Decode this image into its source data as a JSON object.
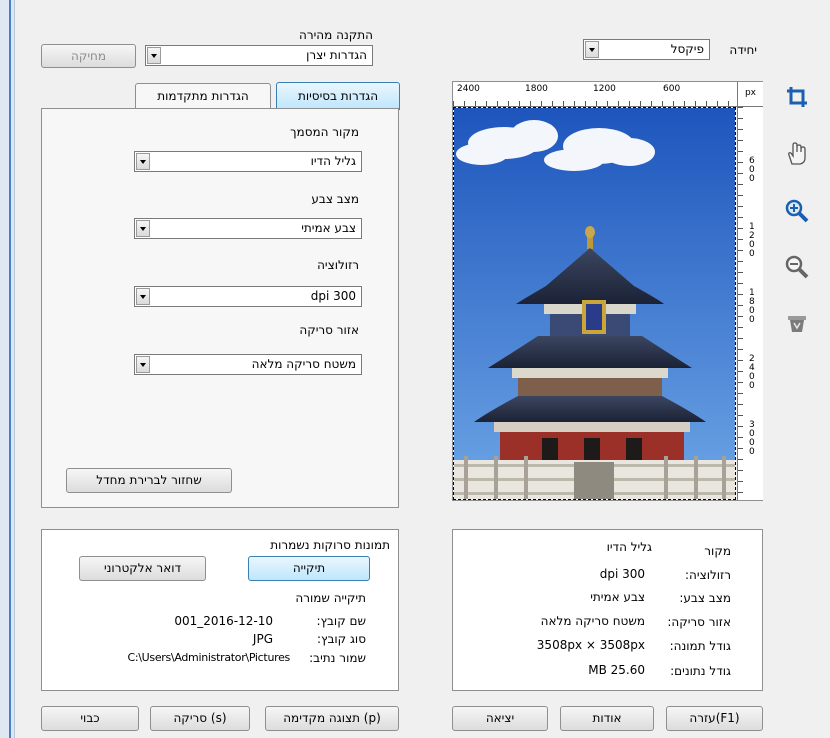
{
  "left_edge": {
    "color": "#4a7fc1"
  },
  "quick_setting": {
    "label": "התקנה מהירה",
    "value": "הגדרות יצרן",
    "delete_label": "מחיקה"
  },
  "unit": {
    "label": "יחידה",
    "value": "פיקסל"
  },
  "tabs": {
    "basic": "הגדרות בסיסיות",
    "advanced": "הגדרות מתקדמות"
  },
  "settings": {
    "source_label": "מקור המסמך",
    "source_value": "גליל הדיו",
    "color_label": "מצב צבע",
    "color_value": "צבע אמיתי",
    "resolution_label": "רזולוציה",
    "resolution_value": "dpi 300",
    "area_label": "אזור סריקה",
    "area_value": "משטח סריקה מלאה",
    "restore_label": "שחזור לברירת מחדל"
  },
  "ruler": {
    "unit": "px",
    "top_ticks": [
      "2400",
      "1800",
      "1200",
      "600"
    ],
    "side_ticks": [
      "600",
      "1200",
      "1800",
      "2400",
      "3000"
    ]
  },
  "tools": [
    "crop-icon",
    "hand-icon",
    "zoom-in-icon",
    "zoom-out-icon",
    "recycle-bin-icon"
  ],
  "saved": {
    "title": "תמונות סרוקות נשמרות",
    "folder_btn": "תיקייה",
    "email_btn": "דואר אלקטרוני",
    "folder_label": "תיקייה שמורה",
    "filename_label": "שם קובץ:",
    "filename_value": "001_2016-12-10",
    "filetype_label": "סוג קובץ:",
    "filetype_value": "JPG",
    "path_label": "שמור נתיב:",
    "path_value": "C:\\Users\\Administrator\\Pictures"
  },
  "info": {
    "source_label": "מקור",
    "source_value": "גליל הדיו",
    "resolution_label": "רזולוציה:",
    "resolution_value": "dpi 300",
    "color_label": "מצב צבע:",
    "color_value": "צבע אמיתי",
    "area_label": "אזור סריקה:",
    "area_value": "משטח סריקה מלאה",
    "image_size_label": "גודל תמונה:",
    "image_size_value": "3508px × 3508px",
    "data_size_label": "גודל נתונים:",
    "data_size_value": "MB 25.60"
  },
  "buttons": {
    "off": "כבוי",
    "scan": "סריקה (s)",
    "preview": "תצוגה מקדימה (p)",
    "exit": "יציאה",
    "about": "אודות",
    "help": "עזרה(F1)"
  }
}
